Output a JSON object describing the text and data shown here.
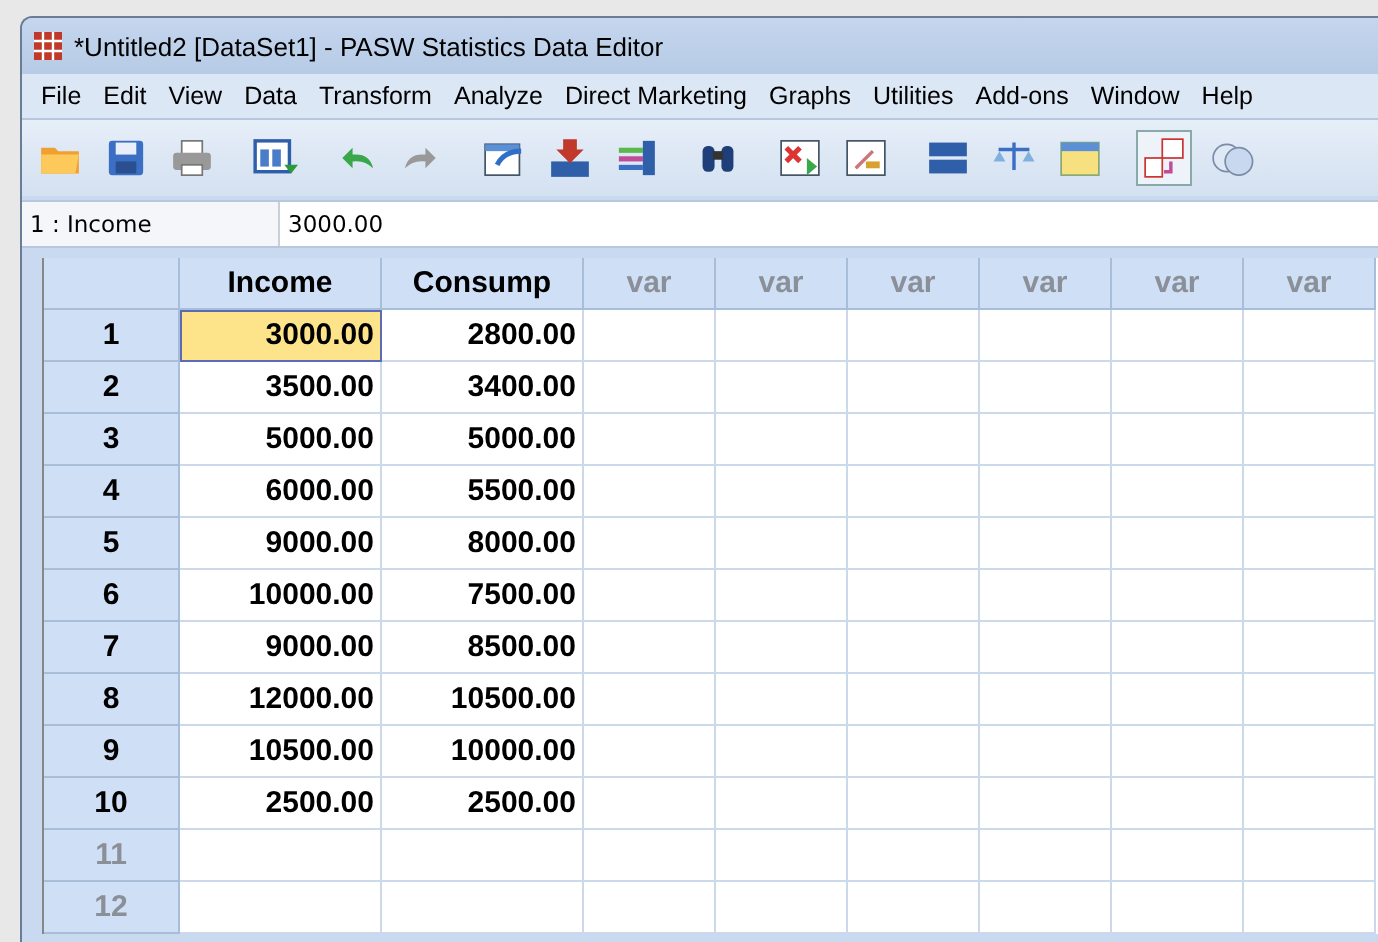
{
  "window": {
    "title": "*Untitled2 [DataSet1] - PASW Statistics Data Editor"
  },
  "menu": [
    "File",
    "Edit",
    "View",
    "Data",
    "Transform",
    "Analyze",
    "Direct Marketing",
    "Graphs",
    "Utilities",
    "Add-ons",
    "Window",
    "Help"
  ],
  "cell_editor": {
    "reference": "1 : Income",
    "value": "3000.00"
  },
  "table": {
    "columns": [
      {
        "label": "Income",
        "defined": true
      },
      {
        "label": "Consump",
        "defined": true
      },
      {
        "label": "var",
        "defined": false
      },
      {
        "label": "var",
        "defined": false
      },
      {
        "label": "var",
        "defined": false
      },
      {
        "label": "var",
        "defined": false
      },
      {
        "label": "var",
        "defined": false
      },
      {
        "label": "var",
        "defined": false
      }
    ],
    "rows": [
      {
        "number": "1",
        "has_data": true,
        "cells": [
          {
            "value": "3000.00",
            "selected": true
          },
          {
            "value": "2800.00",
            "selected": false
          }
        ]
      },
      {
        "number": "2",
        "has_data": true,
        "cells": [
          {
            "value": "3500.00",
            "selected": false
          },
          {
            "value": "3400.00",
            "selected": false
          }
        ]
      },
      {
        "number": "3",
        "has_data": true,
        "cells": [
          {
            "value": "5000.00",
            "selected": false
          },
          {
            "value": "5000.00",
            "selected": false
          }
        ]
      },
      {
        "number": "4",
        "has_data": true,
        "cells": [
          {
            "value": "6000.00",
            "selected": false
          },
          {
            "value": "5500.00",
            "selected": false
          }
        ]
      },
      {
        "number": "5",
        "has_data": true,
        "cells": [
          {
            "value": "9000.00",
            "selected": false
          },
          {
            "value": "8000.00",
            "selected": false
          }
        ]
      },
      {
        "number": "6",
        "has_data": true,
        "cells": [
          {
            "value": "10000.00",
            "selected": false
          },
          {
            "value": "7500.00",
            "selected": false
          }
        ]
      },
      {
        "number": "7",
        "has_data": true,
        "cells": [
          {
            "value": "9000.00",
            "selected": false
          },
          {
            "value": "8500.00",
            "selected": false
          }
        ]
      },
      {
        "number": "8",
        "has_data": true,
        "cells": [
          {
            "value": "12000.00",
            "selected": false
          },
          {
            "value": "10500.00",
            "selected": false
          }
        ]
      },
      {
        "number": "9",
        "has_data": true,
        "cells": [
          {
            "value": "10500.00",
            "selected": false
          },
          {
            "value": "10000.00",
            "selected": false
          }
        ]
      },
      {
        "number": "10",
        "has_data": true,
        "cells": [
          {
            "value": "2500.00",
            "selected": false
          },
          {
            "value": "2500.00",
            "selected": false
          }
        ]
      },
      {
        "number": "11",
        "has_data": false,
        "cells": []
      },
      {
        "number": "12",
        "has_data": false,
        "cells": []
      }
    ]
  }
}
